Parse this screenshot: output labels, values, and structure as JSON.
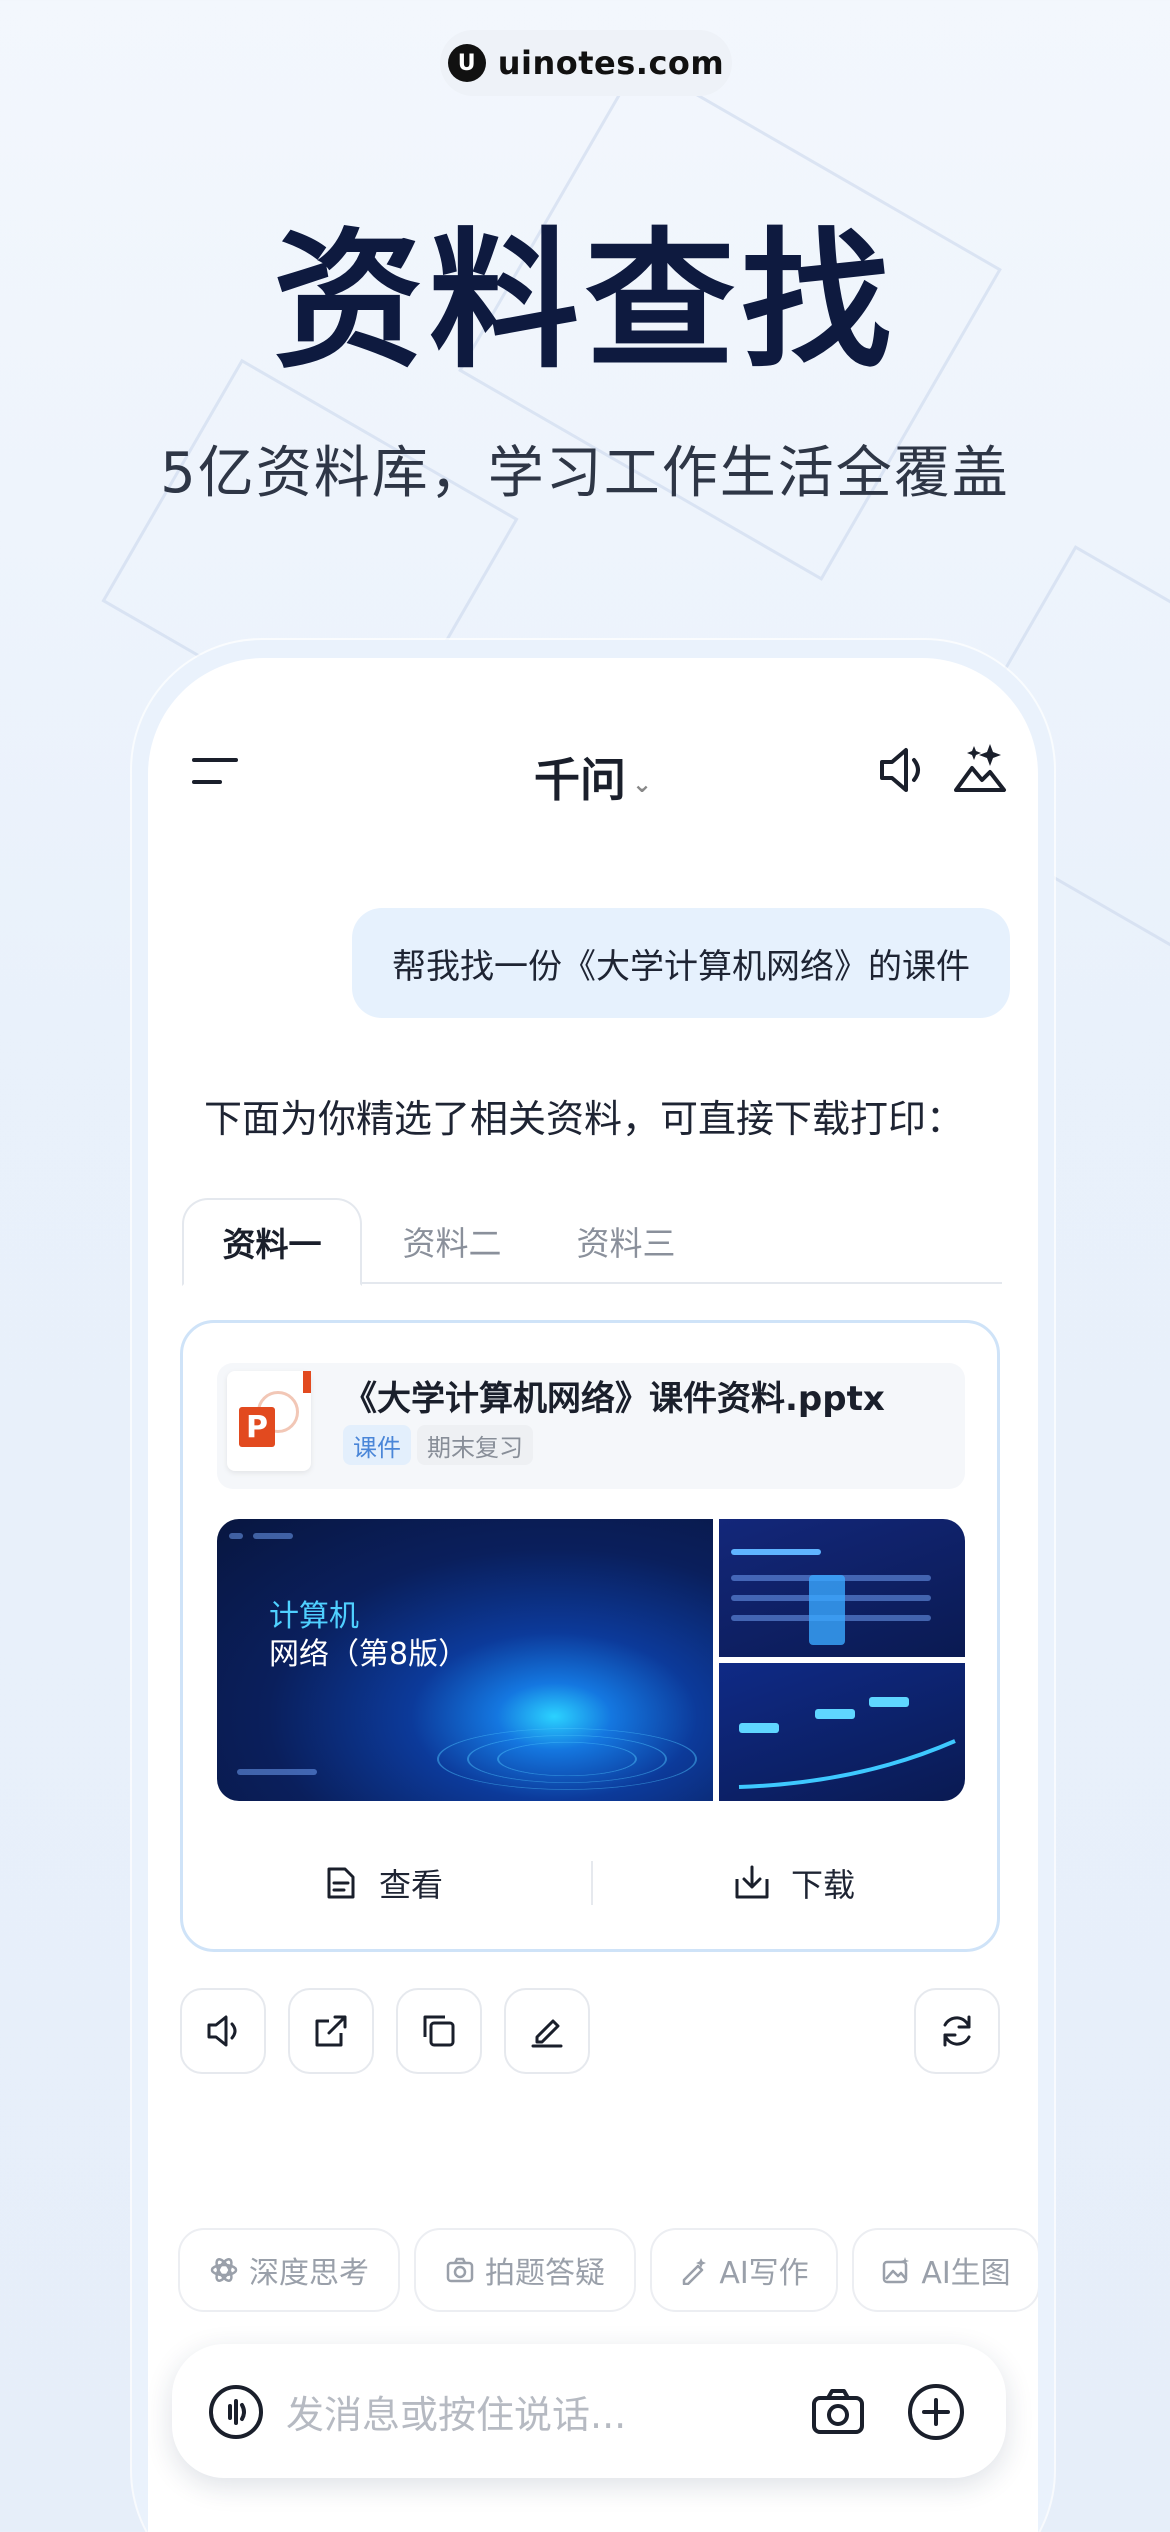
{
  "brand": {
    "logo_glyph": "U",
    "name": "uinotes.com"
  },
  "headline": "资料查找",
  "subline": "5亿资料库，学习工作生活全覆盖",
  "app": {
    "title": "千问",
    "title_chevron": "⌄"
  },
  "chat": {
    "user_message": "帮我找一份《大学计算机网络》的课件",
    "assistant_intro": "下面为你精选了相关资料，可直接下载打印："
  },
  "tabs": [
    {
      "label": "资料一",
      "active": true
    },
    {
      "label": "资料二",
      "active": false
    },
    {
      "label": "资料三",
      "active": false
    }
  ],
  "file": {
    "icon_letter": "P",
    "name": "《大学计算机网络》课件资料.pptx",
    "tags": [
      "课件",
      "期末复习"
    ],
    "preview_title_line1": "计算机",
    "preview_title_line2": "网络（第8版）"
  },
  "card_actions": {
    "view": "查看",
    "download": "下载"
  },
  "message_tools": [
    "speaker-icon",
    "share-icon",
    "copy-icon",
    "edit-icon",
    "refresh-icon"
  ],
  "chips": [
    {
      "label": "深度思考",
      "icon": "atom-icon"
    },
    {
      "label": "拍题答疑",
      "icon": "camera-scan-icon"
    },
    {
      "label": "AI写作",
      "icon": "pen-sparkle-icon"
    },
    {
      "label": "AI生图",
      "icon": "image-sparkle-icon"
    }
  ],
  "input": {
    "placeholder": "发消息或按住说话..."
  },
  "colors": {
    "accent": "#e6f1fd",
    "headline": "#0e1a3f",
    "card_border": "#cfe3f8",
    "tag_blue": "#4a86d8"
  }
}
